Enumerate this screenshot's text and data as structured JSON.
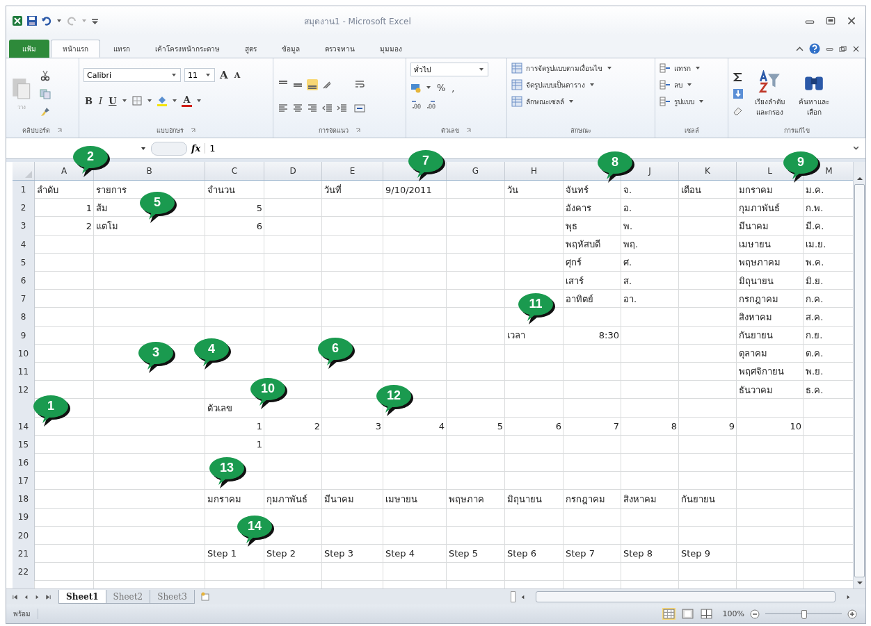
{
  "window": {
    "title": "สมุดงาน1 - Microsoft Excel"
  },
  "ribbon_tabs": [
    {
      "label": "แฟ้ม",
      "kind": "file",
      "selected": false
    },
    {
      "label": "หน้าแรก",
      "kind": "tab",
      "selected": true
    },
    {
      "label": "แทรก",
      "kind": "tab",
      "selected": false
    },
    {
      "label": "เค้าโครงหน้ากระดาษ",
      "kind": "tab",
      "selected": false
    },
    {
      "label": "สูตร",
      "kind": "tab",
      "selected": false
    },
    {
      "label": "ข้อมูล",
      "kind": "tab",
      "selected": false
    },
    {
      "label": "ตรวจทาน",
      "kind": "tab",
      "selected": false
    },
    {
      "label": "มุมมอง",
      "kind": "tab",
      "selected": false
    }
  ],
  "ribbon": {
    "clipboard": {
      "paste": "วาง",
      "label": "คลิปบอร์ด"
    },
    "font": {
      "name": "Calibri",
      "size": "11",
      "grow": "A",
      "shrink": "A",
      "bold": "B",
      "italic": "I",
      "underline": "U",
      "color_letter": "A",
      "label": "แบบอักษร"
    },
    "alignment": {
      "label": "การจัดแนว"
    },
    "number": {
      "format": "ทั่วไป",
      "percent": "%",
      "comma": ",",
      "label": "ตัวเลข"
    },
    "styles": {
      "buttons": [
        "การจัดรูปแบบตามเงื่อนไข",
        "จัดรูปแบบเป็นตาราง",
        "ลักษณะเซลล์"
      ],
      "label": "ลักษณะ"
    },
    "cells": {
      "buttons": [
        "แทรก",
        "ลบ",
        "รูปแบบ"
      ],
      "label": "เซลล์"
    },
    "editing": {
      "sort": "เรียงลำดับและกรอง",
      "find": "ค้นหาและเลือก",
      "label": "การแก้ไข"
    }
  },
  "formula_bar": {
    "function_label": "fx",
    "value": "1"
  },
  "sheet": {
    "columns": [
      "A",
      "B",
      "C",
      "D",
      "E",
      null,
      "G",
      "H",
      null,
      "J",
      "K",
      "L",
      "M"
    ],
    "rows": [
      {
        "number": "1",
        "cells": [
          {
            "text": "ลำดับ",
            "kind": "text"
          },
          {
            "text": "รายการ",
            "kind": "text"
          },
          {
            "text": "จำนวน",
            "kind": "text"
          },
          null,
          {
            "text": "วันที่",
            "kind": "text"
          },
          {
            "text": "9/10/2011",
            "kind": "text"
          },
          null,
          {
            "text": "วัน",
            "kind": "text"
          },
          {
            "text": "จันทร์",
            "kind": "text"
          },
          {
            "text": "จ.",
            "kind": "text"
          },
          {
            "text": "เดือน",
            "kind": "text"
          },
          {
            "text": "มกราคม",
            "kind": "text"
          },
          {
            "text": "ม.ค.",
            "kind": "text"
          }
        ]
      },
      {
        "number": "2",
        "cells": [
          {
            "text": "1",
            "kind": "number"
          },
          {
            "text": "ส้ม",
            "kind": "text"
          },
          {
            "text": "5",
            "kind": "number"
          },
          null,
          null,
          null,
          null,
          null,
          {
            "text": "อังคาร",
            "kind": "text"
          },
          {
            "text": "อ.",
            "kind": "text"
          },
          null,
          {
            "text": "กุมภาพันธ์",
            "kind": "text"
          },
          {
            "text": "ก.พ.",
            "kind": "text"
          }
        ]
      },
      {
        "number": "3",
        "cells": [
          {
            "text": "2",
            "kind": "number"
          },
          {
            "text": "แตโม",
            "kind": "text"
          },
          {
            "text": "6",
            "kind": "number"
          },
          null,
          null,
          null,
          null,
          null,
          {
            "text": "พุธ",
            "kind": "text"
          },
          {
            "text": "พ.",
            "kind": "text"
          },
          null,
          {
            "text": "มีนาคม",
            "kind": "text"
          },
          {
            "text": "มี.ค.",
            "kind": "text"
          }
        ]
      },
      {
        "number": "4",
        "cells": [
          null,
          null,
          null,
          null,
          null,
          null,
          null,
          null,
          {
            "text": "พฤหัสบดี",
            "kind": "text"
          },
          {
            "text": "พฤ.",
            "kind": "text"
          },
          null,
          {
            "text": "เมษายน",
            "kind": "text"
          },
          {
            "text": "เม.ย.",
            "kind": "text"
          }
        ]
      },
      {
        "number": "5",
        "cells": [
          null,
          null,
          null,
          null,
          null,
          null,
          null,
          null,
          {
            "text": "ศุกร์",
            "kind": "text"
          },
          {
            "text": "ศ.",
            "kind": "text"
          },
          null,
          {
            "text": "พฤษภาคม",
            "kind": "text"
          },
          {
            "text": "พ.ค.",
            "kind": "text"
          }
        ]
      },
      {
        "number": "6",
        "cells": [
          null,
          null,
          null,
          null,
          null,
          null,
          null,
          null,
          {
            "text": "เสาร์",
            "kind": "text"
          },
          {
            "text": "ส.",
            "kind": "text"
          },
          null,
          {
            "text": "มิถุนายน",
            "kind": "text"
          },
          {
            "text": "มิ.ย.",
            "kind": "text"
          }
        ]
      },
      {
        "number": "7",
        "cells": [
          null,
          null,
          null,
          null,
          null,
          null,
          null,
          null,
          {
            "text": "อาทิตย์",
            "kind": "text"
          },
          {
            "text": "อา.",
            "kind": "text"
          },
          null,
          {
            "text": "กรกฎาคม",
            "kind": "text"
          },
          {
            "text": "ก.ค.",
            "kind": "text"
          }
        ]
      },
      {
        "number": "8",
        "cells": [
          null,
          null,
          null,
          null,
          null,
          null,
          null,
          null,
          null,
          null,
          null,
          {
            "text": "สิงหาคม",
            "kind": "text"
          },
          {
            "text": "ส.ค.",
            "kind": "text"
          }
        ]
      },
      {
        "number": "9",
        "cells": [
          null,
          null,
          null,
          null,
          null,
          null,
          null,
          {
            "text": "เวลา",
            "kind": "text"
          },
          {
            "text": "8:30",
            "kind": "number"
          },
          null,
          null,
          {
            "text": "กันยายน",
            "kind": "text"
          },
          {
            "text": "ก.ย.",
            "kind": "text"
          }
        ]
      },
      {
        "number": "10",
        "cells": [
          null,
          null,
          null,
          null,
          null,
          null,
          null,
          null,
          null,
          null,
          null,
          {
            "text": "ตุลาคม",
            "kind": "text"
          },
          {
            "text": "ต.ค.",
            "kind": "text"
          }
        ]
      },
      {
        "number": "11",
        "cells": [
          null,
          null,
          null,
          null,
          null,
          null,
          null,
          null,
          null,
          null,
          null,
          {
            "text": "พฤศจิกายน",
            "kind": "text"
          },
          {
            "text": "พ.ย.",
            "kind": "text"
          }
        ]
      },
      {
        "number": "12",
        "cells": [
          null,
          null,
          null,
          null,
          null,
          null,
          null,
          null,
          null,
          null,
          null,
          {
            "text": "ธันวาคม",
            "kind": "text"
          },
          {
            "text": "ธ.ค.",
            "kind": "text"
          }
        ]
      },
      {
        "cells": [
          null,
          null,
          {
            "text": "ตัวเลข",
            "kind": "text"
          },
          null,
          null,
          null,
          null,
          null,
          null,
          null,
          null,
          null,
          null
        ]
      },
      {
        "number": "14",
        "cells": [
          null,
          null,
          {
            "text": "1",
            "kind": "number"
          },
          {
            "text": "2",
            "kind": "number"
          },
          {
            "text": "3",
            "kind": "number"
          },
          {
            "text": "4",
            "kind": "number"
          },
          {
            "text": "5",
            "kind": "number"
          },
          {
            "text": "6",
            "kind": "number"
          },
          {
            "text": "7",
            "kind": "number"
          },
          {
            "text": "8",
            "kind": "number"
          },
          {
            "text": "9",
            "kind": "number"
          },
          {
            "text": "10",
            "kind": "number"
          },
          null
        ]
      },
      {
        "number": "15",
        "cells": [
          null,
          null,
          {
            "text": "1",
            "kind": "number"
          },
          null,
          null,
          null,
          null,
          null,
          null,
          null,
          null,
          null,
          null
        ]
      },
      {
        "number": "16",
        "cells": [
          null,
          null,
          null,
          null,
          null,
          null,
          null,
          null,
          null,
          null,
          null,
          null,
          null
        ]
      },
      {
        "number": "17",
        "cells": [
          null,
          null,
          null,
          null,
          null,
          null,
          null,
          null,
          null,
          null,
          null,
          null,
          null
        ]
      },
      {
        "number": "18",
        "cells": [
          null,
          null,
          {
            "text": "มกราคม",
            "kind": "text"
          },
          {
            "text": "กุมภาพันธ์",
            "kind": "text"
          },
          {
            "text": "มีนาคม",
            "kind": "text"
          },
          {
            "text": "เมษายน",
            "kind": "text"
          },
          {
            "text": "พฤษภาค",
            "kind": "text"
          },
          {
            "text": "มิถุนายน",
            "kind": "text"
          },
          {
            "text": "กรกฎาคม",
            "kind": "text"
          },
          {
            "text": "สิงหาคม",
            "kind": "text"
          },
          {
            "text": "กันยายน",
            "kind": "text"
          },
          null,
          null
        ]
      },
      {
        "number": "19",
        "cells": [
          null,
          null,
          null,
          null,
          null,
          null,
          null,
          null,
          null,
          null,
          null,
          null,
          null
        ]
      },
      {
        "number": "20",
        "cells": [
          null,
          null,
          null,
          null,
          null,
          null,
          null,
          null,
          null,
          null,
          null,
          null,
          null
        ]
      },
      {
        "number": "21",
        "cells": [
          null,
          null,
          {
            "text": "Step 1",
            "kind": "text"
          },
          {
            "text": "Step 2",
            "kind": "text"
          },
          {
            "text": "Step 3",
            "kind": "text"
          },
          {
            "text": "Step 4",
            "kind": "text"
          },
          {
            "text": "Step 5",
            "kind": "text"
          },
          {
            "text": "Step 6",
            "kind": "text"
          },
          {
            "text": "Step 7",
            "kind": "text"
          },
          {
            "text": "Step 8",
            "kind": "text"
          },
          {
            "text": "Step 9",
            "kind": "text"
          },
          null,
          null
        ]
      },
      {
        "number": "22",
        "cells": [
          null,
          null,
          null,
          null,
          null,
          null,
          null,
          null,
          null,
          null,
          null,
          null,
          null
        ]
      }
    ]
  },
  "sheet_tabs": [
    {
      "label": "Sheet1",
      "selected": true
    },
    {
      "label": "Sheet2",
      "selected": false
    },
    {
      "label": "Sheet3",
      "selected": false
    }
  ],
  "status_bar": {
    "status": "พร้อม",
    "zoom": "100%",
    "zoom_slider": {
      "level": 0.5
    }
  },
  "callouts": [
    "1",
    "2",
    "3",
    "4",
    "5",
    "6",
    "7",
    "8",
    "9",
    "10",
    "11",
    "12",
    "13",
    "14"
  ]
}
